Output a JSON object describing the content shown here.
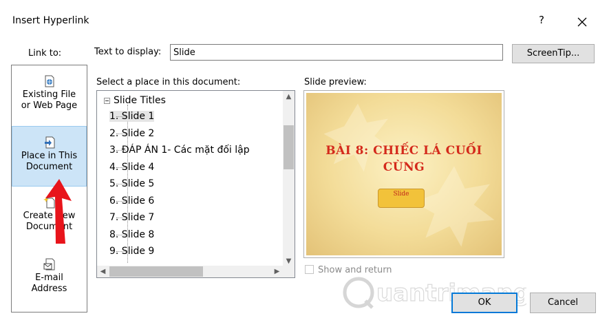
{
  "dialog": {
    "title": "Insert Hyperlink",
    "help_label": "?",
    "close_icon": "close-icon"
  },
  "link_to": {
    "label": "Link to:",
    "items": [
      {
        "label_line1": "Existing File",
        "label_line2": "or Web Page",
        "icon": "globe-file-icon"
      },
      {
        "label_line1": "Place in This",
        "label_line2": "Document",
        "icon": "document-place-icon",
        "selected": true
      },
      {
        "label_line1": "Create New",
        "label_line2": "Document",
        "icon": "new-document-icon"
      },
      {
        "label_line1": "E-mail",
        "label_line2": "Address",
        "icon": "email-icon"
      }
    ]
  },
  "text_to_display": {
    "label": "Text to display:",
    "value": "Slide"
  },
  "screentip": {
    "label": "ScreenTip..."
  },
  "place": {
    "label": "Select a place in this document:",
    "root": "Slide Titles",
    "items": [
      "1. Slide 1",
      "2. Slide 2",
      "3. ĐÁP ÁN 1- Các mặt đối lập",
      "4. Slide 4",
      "5. Slide 5",
      "6. Slide 6",
      "7. Slide 7",
      "8. Slide 8",
      "9. Slide 9"
    ],
    "selected_index": 0
  },
  "preview": {
    "label": "Slide preview:",
    "slide_title_line1": "BÀI 8: CHIẾC LÁ CUỐI",
    "slide_title_line2": "CÙNG",
    "slide_button": "Slide",
    "colors": {
      "title": "#d42a1c",
      "button": "#f2c23a",
      "background": "#f3dc98"
    }
  },
  "show_and_return": {
    "label": "Show and return",
    "checked": false,
    "enabled": false
  },
  "watermark": {
    "text": "uantrimang"
  },
  "buttons": {
    "ok": "OK",
    "cancel": "Cancel"
  },
  "accent_color": "#0078d7",
  "annotation_arrow_color": "#e8141b"
}
